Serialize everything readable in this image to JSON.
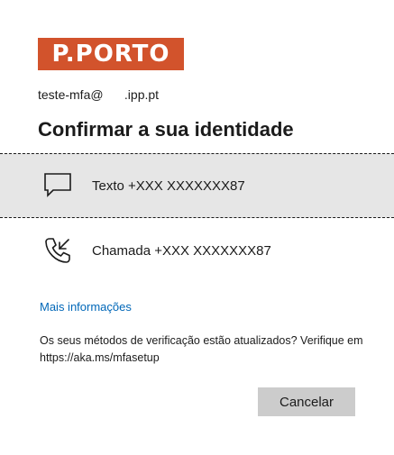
{
  "logo": {
    "text": "P.PORTO",
    "color": "#d2532c"
  },
  "user": {
    "identifier": "teste-mfa@      .ipp.pt"
  },
  "title": "Confirmar a sua identidade",
  "options": [
    {
      "icon": "chat-bubble-icon",
      "label": "Texto +XXX XXXXXXX87",
      "selected": true
    },
    {
      "icon": "phone-call-icon",
      "label": "Chamada +XXX XXXXXXX87",
      "selected": false
    }
  ],
  "links": {
    "more_info": "Mais informações"
  },
  "notice": "Os seus métodos de verificação estão atualizados? Verifique em https://aka.ms/mfasetup",
  "buttons": {
    "cancel": "Cancelar"
  },
  "colors": {
    "link": "#0067b8",
    "selected_bg": "#e6e6e6",
    "button_bg": "#cccccc"
  }
}
